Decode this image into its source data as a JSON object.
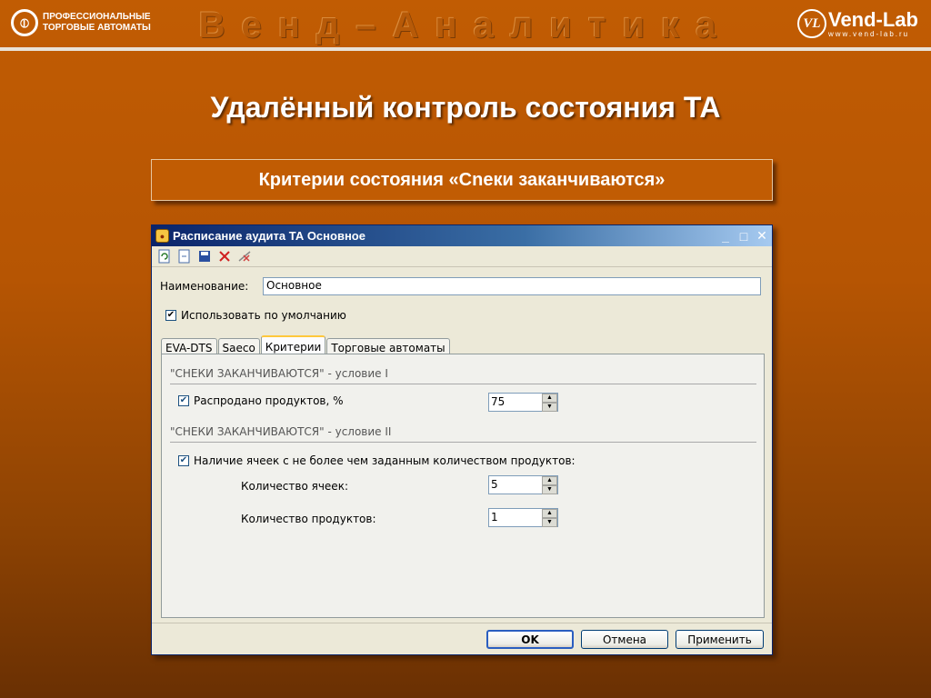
{
  "slide": {
    "logo_left_line1": "ПРОФЕССИОНАЛЬНЫЕ",
    "logo_left_line2": "ТОРГОВЫЕ АВТОМАТЫ",
    "banner": "Венд–Аналитика",
    "logo_right_brand": "Vend-Lab",
    "logo_right_url": "www.vend-lab.ru",
    "logo_right_mark": "VL",
    "title": "Удалённый контроль состояния ТА",
    "subtitle": "Критерии состояния «Сneки заканчиваются»"
  },
  "window": {
    "title": "Расписание аудита ТА Основное",
    "controls": {
      "minimize": "_",
      "maximize": "□",
      "close": "✕"
    },
    "toolbar": [
      "refresh-icon",
      "new-icon",
      "save-icon",
      "delete-icon",
      "clear-icon"
    ],
    "name_label": "Наименование:",
    "name_value": "Основное",
    "default_checkbox_label": "Использовать по умолчанию",
    "default_checked": true,
    "tabs": [
      "EVA-DTS",
      "Saeco",
      "Критерии",
      "Торговые автоматы"
    ],
    "active_tab": "Критерии",
    "group1_title": "\"СНЕКИ ЗАКАНЧИВАЮТСЯ\" - условие I",
    "sold_label": "Распродано продуктов, %",
    "sold_checked": true,
    "sold_value": "75",
    "group2_title": "\"СНЕКИ ЗАКАНЧИВАЮТСЯ\" - условие II",
    "cells_condition_label": "Наличие ячеек с не более чем заданным количеством продуктов:",
    "cells_condition_checked": true,
    "cells_count_label": "Количество ячеек:",
    "cells_count_value": "5",
    "products_count_label": "Количество продуктов:",
    "products_count_value": "1",
    "buttons": {
      "ok": "OK",
      "cancel": "Отмена",
      "apply": "Применить"
    }
  },
  "colors": {
    "background": "#c15c03",
    "titlebar": "#0a246a",
    "window": "#ece9d8"
  }
}
